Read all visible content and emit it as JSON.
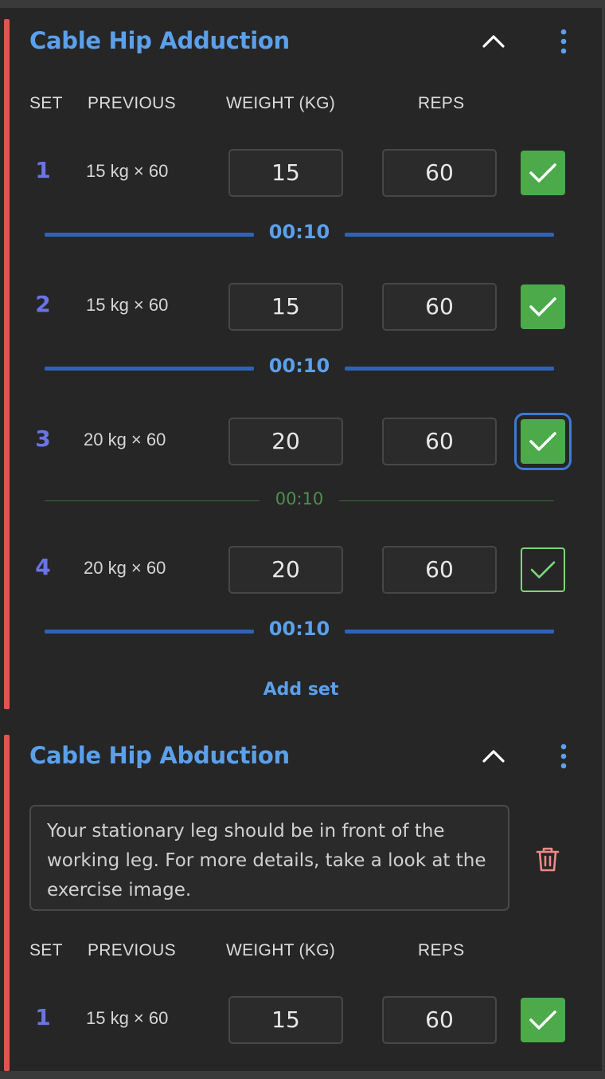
{
  "colors": {
    "accent_bar": "#e2544f",
    "title_blue": "#5aa0ec",
    "set_number": "#6a74e8",
    "done_green": "#4caa4a",
    "timer_blue": "#2e64b8",
    "trash_red": "#f08a86"
  },
  "icons": {
    "collapse": "chevron-up-icon",
    "menu": "more-vertical-icon",
    "done": "checkmark-icon",
    "delete": "trash-icon"
  },
  "headers": {
    "set": "SET",
    "previous": "PREVIOUS",
    "weight": "WEIGHT (KG)",
    "reps": "REPS"
  },
  "exercises": [
    {
      "title": "Cable Hip Adduction",
      "sets": [
        {
          "num": "1",
          "previous": "15 kg × 60",
          "weight": "15",
          "reps": "60",
          "done": true,
          "timer": "00:10"
        },
        {
          "num": "2",
          "previous": "15 kg × 60",
          "weight": "15",
          "reps": "60",
          "done": true,
          "timer": "00:10"
        },
        {
          "num": "3",
          "previous": "20 kg × 60",
          "weight": "20",
          "reps": "60",
          "done": true,
          "timer": "00:10"
        },
        {
          "num": "4",
          "previous": "20 kg × 60",
          "weight": "20",
          "reps": "60",
          "done": false,
          "timer": "00:10"
        }
      ],
      "add_set": "Add set"
    },
    {
      "title": "Cable Hip Abduction",
      "note": "Your stationary leg should be in front of the working leg. For more details, take a look at the exercise image.",
      "sets": [
        {
          "num": "1",
          "previous": "15 kg × 60",
          "weight": "15",
          "reps": "60",
          "done": true
        }
      ]
    }
  ]
}
